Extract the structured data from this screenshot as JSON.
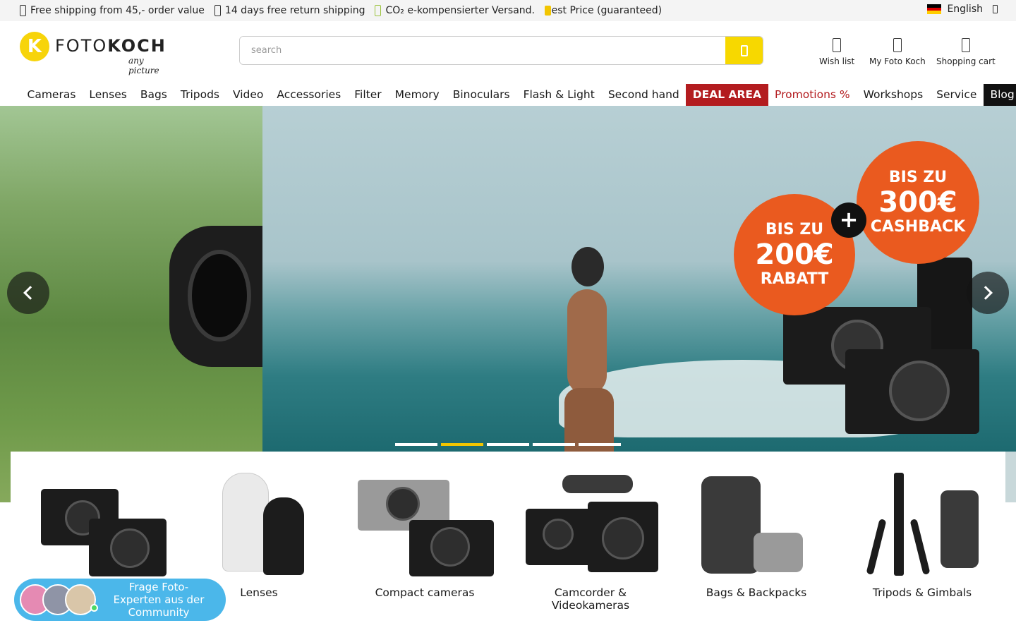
{
  "topbar": {
    "usps": [
      "Free shipping from 45,- order value",
      "14 days free return shipping",
      "CO₂ e-kompensierter Versand.",
      "Best Price (guaranteed)"
    ],
    "language": "English"
  },
  "header": {
    "logo_word_light": "FOTO",
    "logo_word_bold": "KOCH",
    "logo_tagline": "any picture",
    "search_placeholder": "search",
    "wishlist_label": "Wish list",
    "account_label": "My Foto Koch",
    "cart_label": "Shopping cart"
  },
  "nav": {
    "items": [
      "Cameras",
      "Lenses",
      "Bags",
      "Tripods",
      "Video",
      "Accessories",
      "Filter",
      "Memory",
      "Binoculars",
      "Flash & Light",
      "Second hand"
    ],
    "deal": "DEAL AREA",
    "promotions": "Promotions %",
    "workshops": "Workshops",
    "service": "Service",
    "blog": "Blog"
  },
  "hero": {
    "badge1_small_top": "BIS ZU",
    "badge1_big": "200€",
    "badge1_small_bottom": "RABATT",
    "badge2_small_top": "BIS ZU",
    "badge2_big": "300€",
    "badge2_small_bottom": "CASHBACK",
    "plus": "+",
    "active_slide": 2,
    "slide_count": 5
  },
  "categories": [
    {
      "label": ""
    },
    {
      "label": "Lenses"
    },
    {
      "label": "Compact cameras"
    },
    {
      "label": "Camcorder & Videokameras"
    },
    {
      "label": "Bags & Backpacks"
    },
    {
      "label": "Tripods & Gimbals"
    }
  ],
  "chat": {
    "text": "Frage Foto-Experten aus der Community"
  },
  "colors": {
    "accent_yellow": "#f7d800",
    "deal_red": "#b31c1f",
    "chat_blue": "#4bb7ea",
    "badge_orange": "#ea5a1f"
  }
}
